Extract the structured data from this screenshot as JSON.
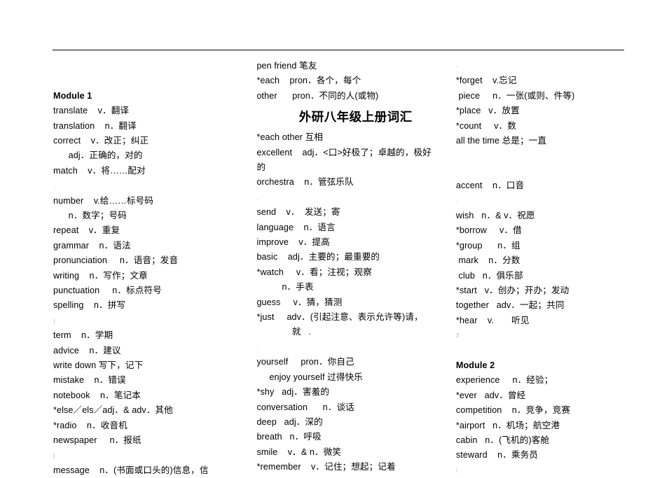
{
  "document": {
    "title": "外研八年级上册词汇",
    "rule_color": "#000000",
    "background_color": "#ffffff"
  },
  "columns": {
    "left": {
      "heading": "Module 1",
      "entries": [
        {
          "text": "translate    v．翻译"
        },
        {
          "text": "translation    n．翻译"
        },
        {
          "text": "correct    v．改正；纠正"
        },
        {
          "text": "      adj．正确的，对的"
        },
        {
          "text": "match    v．将……配对"
        },
        {
          "mark": ","
        },
        {
          "text": "number    v.给……标号码"
        },
        {
          "text": "      n．数字；号码"
        },
        {
          "text": "repeat    v．重复"
        },
        {
          "text": "grammar    n．语法"
        },
        {
          "text": "pronunciation     n．语音；发音"
        },
        {
          "text": "writing    n．写作；文章"
        },
        {
          "text": "punctuation     n．标点符号"
        },
        {
          "text": "spelling    n．拼写"
        },
        {
          "mark": ")"
        },
        {
          "text": "term    n．学期"
        },
        {
          "text": "advice    n．建议"
        },
        {
          "text": "write down 写下，记下"
        },
        {
          "text": "mistake    n．错误"
        },
        {
          "text": "notebook    n．笔记本"
        },
        {
          "text": "*else／els／adj．& adv．其他"
        },
        {
          "text": "*radio    n．收音机"
        },
        {
          "text": "newspaper     n．报纸"
        },
        {
          "mark": "("
        },
        {
          "text": "message    n．(书面或口头的)信息，信"
        }
      ]
    },
    "mid": {
      "entries_before_title": [
        {
          "text": "pen friend 笔友"
        },
        {
          "text": "*each    pron．各个，每个"
        },
        {
          "text": "other      pron．不同的人(或物)"
        }
      ],
      "entries_after_title": [
        {
          "text": "*each other 互相"
        },
        {
          "text": "excellent    adj．<口>好极了；卓越的，极好"
        },
        {
          "text": "的"
        },
        {
          "text": "orchestra    n．管弦乐队"
        },
        {
          "mark": ","
        },
        {
          "text": "send    v．  发送；寄"
        },
        {
          "text": "language    n．语言"
        },
        {
          "text": "improve    v．提高"
        },
        {
          "text": "basic    adj．主要的；最重要的"
        },
        {
          "text": "*watch     v．看；注视；观察"
        },
        {
          "text": "          n．手表"
        },
        {
          "text": "guess     v．猜，猜测"
        },
        {
          "text": "*just     adv．(引起注意、表示允许等)请，"
        },
        {
          "text": "              就   ."
        },
        {
          "mark": ","
        },
        {
          "text": "yourself     pron．你自己"
        },
        {
          "text": "     enjoy yourself 过得快乐"
        },
        {
          "text": "*shy   adj．害羞的"
        },
        {
          "text": "conversation      n．谈话"
        },
        {
          "text": "deep   adj．深的"
        },
        {
          "text": "breath   n．呼吸"
        },
        {
          "text": "smile    v．& n．微笑"
        },
        {
          "text": "*remember    v．记住；想起；记着"
        }
      ]
    },
    "right": {
      "heading": "Module 2",
      "entries_before_heading": [
        {
          "mark": "-"
        },
        {
          "text": "*forget    v.忘记"
        },
        {
          "text": " piece     n．一张(或则、件等)"
        },
        {
          "text": "*place   v．放置"
        },
        {
          "text": "*count     v．数"
        },
        {
          "text": "all the time 总是；一直"
        },
        {
          "gap": true
        },
        {
          "gap": true
        },
        {
          "text": "accent    n．口音"
        },
        {
          "mark": "-"
        },
        {
          "text": "wish   n．& v．祝愿"
        },
        {
          "text": "*borrow     v．借"
        },
        {
          "text": "*group      n．组"
        },
        {
          "text": " mark    n．分数"
        },
        {
          "text": " club   n．俱乐部"
        },
        {
          "text": "*start   v．创办；开办；发动"
        },
        {
          "text": "together   adv．一起；共同"
        },
        {
          "text": "*hear    v.       听见"
        },
        {
          "mark": "3"
        },
        {
          "gap": true
        }
      ],
      "entries_after_heading": [
        {
          "text": "experience     n．经验；"
        },
        {
          "text": "*ever   adv．曾经"
        },
        {
          "text": "competition    n．竞争，竞赛"
        },
        {
          "text": "*airport   n．机场；航空港"
        },
        {
          "text": "cabin   n．(飞机的)客舱"
        },
        {
          "text": "steward    n．乘务员"
        },
        {
          "mark": "/"
        }
      ]
    }
  }
}
